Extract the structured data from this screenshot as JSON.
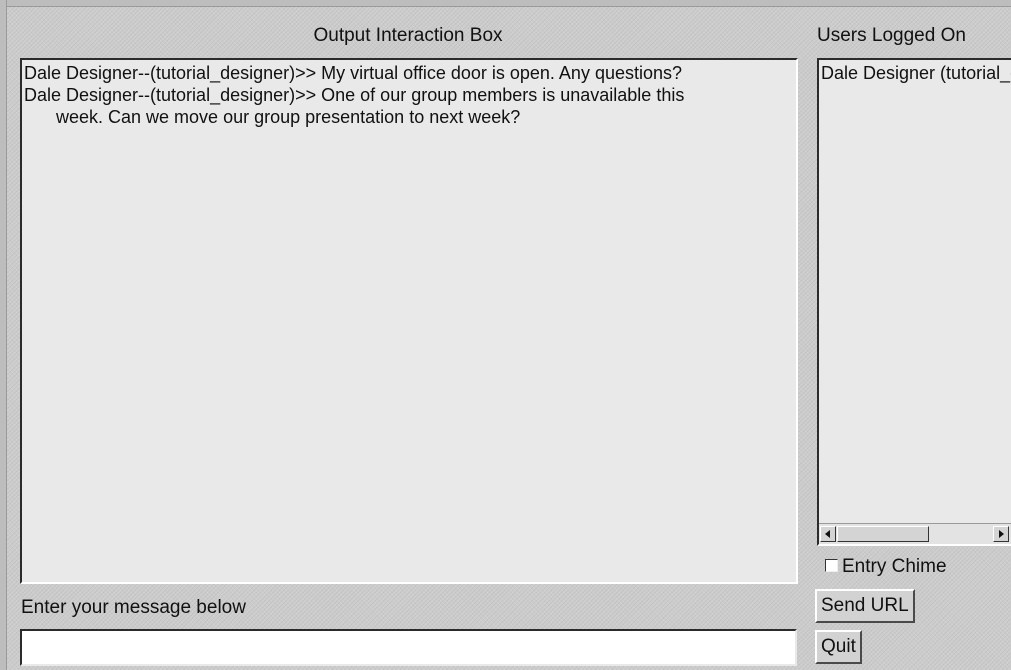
{
  "output": {
    "title": "Output Interaction Box",
    "messages": [
      "Dale  Designer--(tutorial_designer)>> My virtual office door is open. Any questions?",
      "Dale  Designer--(tutorial_designer)>> One of our group members is unavailable this week. Can we move our group presentation to next week?"
    ]
  },
  "users": {
    "title": "Users Logged On",
    "list": [
      "Dale Designer (tutorial_designer)"
    ]
  },
  "chime": {
    "label": "Entry Chime",
    "checked": false
  },
  "input": {
    "label": "Enter your message below",
    "value": ""
  },
  "buttons": {
    "send_url": "Send URL",
    "quit": "Quit"
  }
}
